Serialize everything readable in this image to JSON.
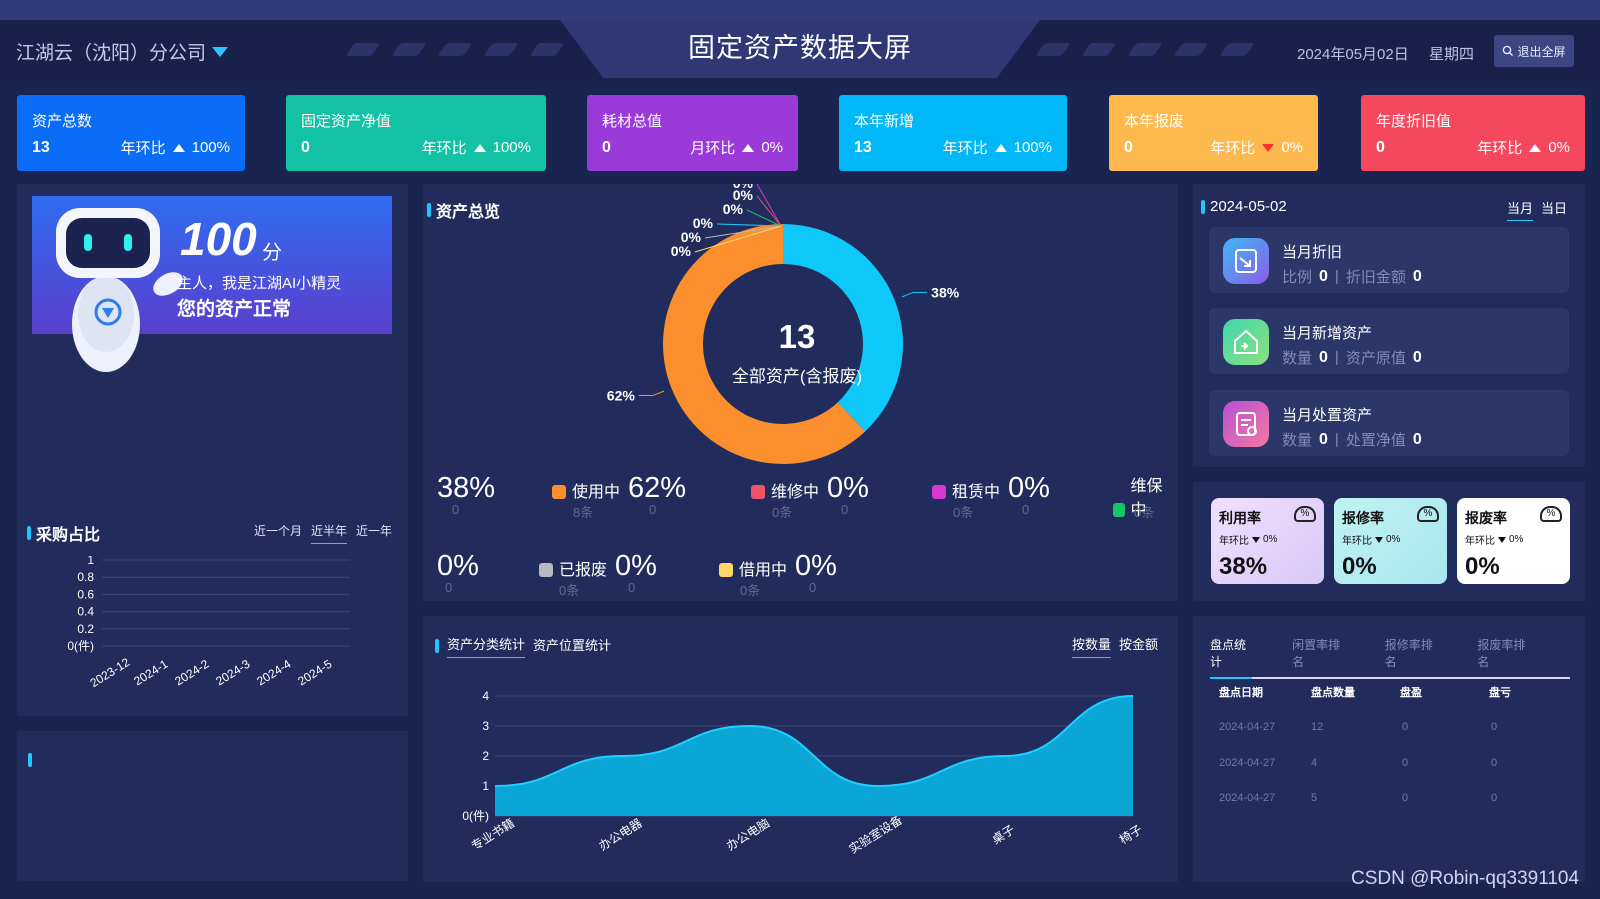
{
  "header": {
    "company": "江湖云（沈阳）分公司",
    "title": "固定资产数据大屏",
    "date": "2024年05月02日",
    "weekday": "星期四",
    "exit_label": "退出全屏"
  },
  "stat_cards": [
    {
      "title": "资产总数",
      "value": "13",
      "cmp_label": "年环比",
      "cmp_value": "100%",
      "trend": "up",
      "color": "#0a6cf7"
    },
    {
      "title": "固定资产净值",
      "value": "0",
      "cmp_label": "年环比",
      "cmp_value": "100%",
      "trend": "up",
      "color": "#13c2a5"
    },
    {
      "title": "耗材总值",
      "value": "0",
      "cmp_label": "月环比",
      "cmp_value": "0%",
      "trend": "up",
      "color": "#9a3ad8"
    },
    {
      "title": "本年新增",
      "value": "13",
      "cmp_label": "年环比",
      "cmp_value": "100%",
      "trend": "up",
      "color": "#00b7f7"
    },
    {
      "title": "本年报废",
      "value": "0",
      "cmp_label": "年环比",
      "cmp_value": "0%",
      "trend": "down",
      "color": "#fdb94e"
    },
    {
      "title": "年度折旧值",
      "value": "0",
      "cmp_label": "年环比",
      "cmp_value": "0%",
      "trend": "up",
      "color": "#f5475d"
    }
  ],
  "ai": {
    "score": "100",
    "score_unit": "分",
    "greeting": "主人，我是江湖AI小精灵",
    "status": "您的资产正常"
  },
  "purchase": {
    "title": "采购占比",
    "tabs": [
      "近一个月",
      "近半年",
      "近一年"
    ],
    "active_tab": "近半年"
  },
  "overview": {
    "title": "资产总览",
    "center_value": "13",
    "center_label": "全部资产(含报废)",
    "legend": [
      {
        "name": "",
        "pct": "38%",
        "count": "0",
        "sub_pct": "0",
        "color": "#10c8f8"
      },
      {
        "name": "使用中",
        "pct": "62%",
        "count": "8条",
        "sub_pct": "0",
        "color": "#fb8f2d"
      },
      {
        "name": "维修中",
        "pct": "0%",
        "count": "0条",
        "sub_pct": "0",
        "color": "#f05468"
      },
      {
        "name": "租赁中",
        "pct": "0%",
        "count": "0条",
        "sub_pct": "0",
        "color": "#d63ad0"
      },
      {
        "name": "维保中",
        "pct": "",
        "count": "0条",
        "sub_pct": "",
        "color": "#17c466"
      },
      {
        "name": "",
        "pct": "0%",
        "count": "0",
        "sub_pct": "",
        "color": "#20c4ff"
      },
      {
        "name": "已报废",
        "pct": "0%",
        "count": "0条",
        "sub_pct": "0",
        "color": "#b8b8c0"
      },
      {
        "name": "借用中",
        "pct": "0%",
        "count": "0条",
        "sub_pct": "0",
        "color": "#ffd66b"
      }
    ],
    "outer_labels": [
      "0%",
      "0%",
      "0%",
      "0%",
      "0%",
      "0%",
      "38%",
      "62%"
    ]
  },
  "right": {
    "date": "2024-05-02",
    "tabs": [
      "当月",
      "当日"
    ],
    "cards": [
      {
        "title": "当月折旧",
        "k1": "比例",
        "v1": "0",
        "k2": "折旧金额",
        "v2": "0",
        "color": "#6a6fe8"
      },
      {
        "title": "当月新增资产",
        "k1": "数量",
        "v1": "0",
        "k2": "资产原值",
        "v2": "0",
        "color": "#36cfa0"
      },
      {
        "title": "当月处置资产",
        "k1": "数量",
        "v1": "0",
        "k2": "处置净值",
        "v2": "0",
        "color": "#d8569a"
      }
    ],
    "rates": [
      {
        "title": "利用率",
        "sub": "年环比",
        "sub_val": "0%",
        "value": "38%",
        "color": "#e4d0f8"
      },
      {
        "title": "报修率",
        "sub": "年环比",
        "sub_val": "0%",
        "value": "0%",
        "color": "#b2ecf0"
      },
      {
        "title": "报废率",
        "sub": "年环比",
        "sub_val": "0%",
        "value": "0%",
        "color": "#ffffff"
      }
    ]
  },
  "category": {
    "tabs": [
      "资产分类统计",
      "资产位置统计"
    ],
    "right_tabs": [
      "按数量",
      "按金额"
    ]
  },
  "inventory": {
    "tabs": [
      "盘点统计",
      "闲置率排名",
      "报修率排名",
      "报废率排名"
    ],
    "columns": [
      "盘点日期",
      "盘点数量",
      "盘盈",
      "盘亏"
    ],
    "rows": [
      [
        "2024-04-27",
        "12",
        "0",
        "0"
      ],
      [
        "2024-04-27",
        "4",
        "0",
        "0"
      ],
      [
        "2024-04-27",
        "5",
        "0",
        "0"
      ]
    ]
  },
  "watermark": "CSDN @Robin-qq3391104",
  "chart_data": [
    {
      "type": "line",
      "title": "采购占比",
      "categories": [
        "2023-12",
        "2024-1",
        "2024-2",
        "2024-3",
        "2024-4",
        "2024-5"
      ],
      "series": [],
      "y_ticks": [
        "1",
        "0.8",
        "0.6",
        "0.4",
        "0.2",
        "0(件)"
      ],
      "ylim": [
        0,
        1
      ]
    },
    {
      "type": "pie",
      "title": "资产总览",
      "slices": [
        {
          "label": "38%",
          "value": 38,
          "color": "#0ec8fa"
        },
        {
          "label": "62%",
          "value": 62,
          "color": "#fb8f2d"
        }
      ]
    },
    {
      "type": "area",
      "title": "资产分类统计",
      "categories": [
        "专业书籍",
        "办公电器",
        "办公电脑",
        "实验室设备",
        "桌子",
        "椅子"
      ],
      "values": [
        1,
        2,
        3,
        1,
        2,
        4
      ],
      "y_ticks": [
        "4",
        "3",
        "2",
        "1",
        "0(件)"
      ],
      "ylim": [
        0,
        4
      ]
    }
  ]
}
